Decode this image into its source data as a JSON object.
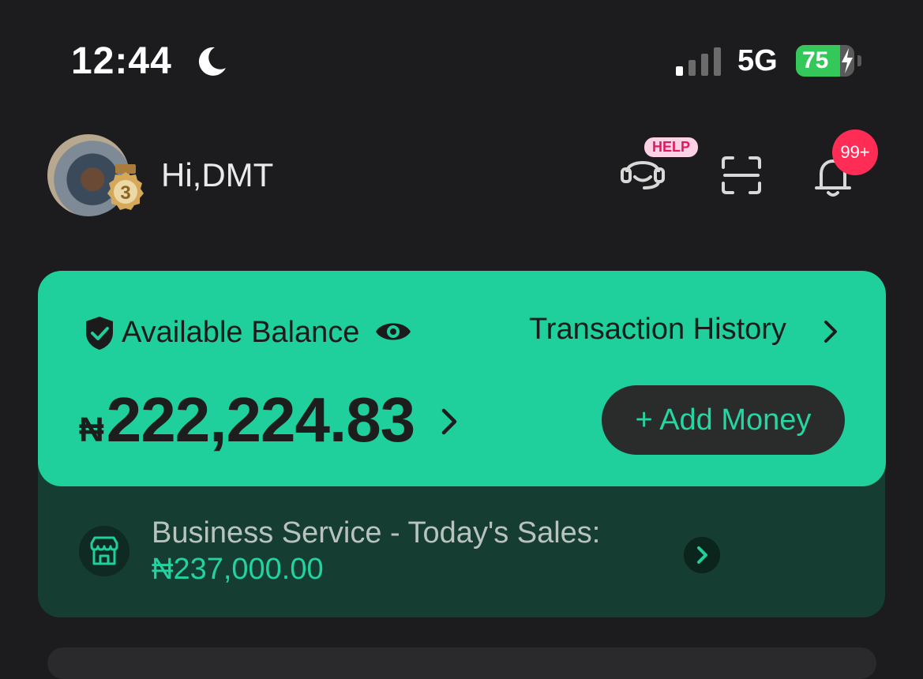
{
  "status_bar": {
    "time": "12:44",
    "network": "5G",
    "battery_level": 75,
    "battery_text": "75",
    "icons": [
      "moon-icon",
      "signal-icon",
      "battery-icon",
      "charging-bolt-icon"
    ]
  },
  "header": {
    "greeting": "Hi,DMT",
    "medal_level": "3",
    "help_badge": "HELP",
    "notification_badge": "99+",
    "icons": [
      "support-headset-icon",
      "scan-icon",
      "bell-icon"
    ]
  },
  "balance_card": {
    "label": "Available Balance",
    "history_label": "Transaction History",
    "currency": "₦",
    "amount": "222,224.83",
    "add_money_label": "+ Add Money",
    "colors": {
      "accent": "#1fcf9c",
      "dark": "#163d31"
    }
  },
  "business": {
    "label": "Business Service - Today's Sales:",
    "amount": "₦237,000.00"
  }
}
